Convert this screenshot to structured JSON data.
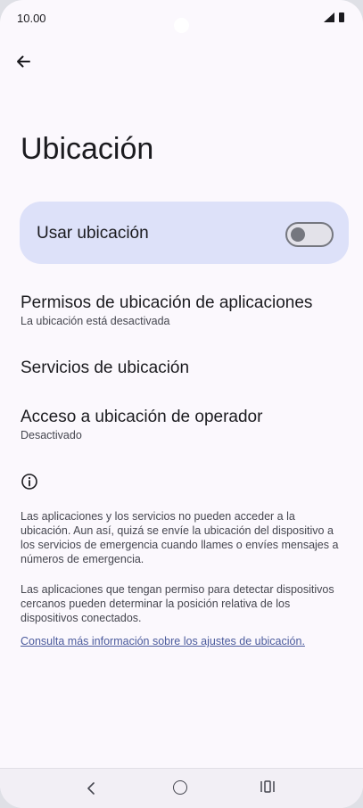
{
  "status_bar": {
    "time": "10.00",
    "icons": [
      "signal-icon",
      "battery-icon"
    ]
  },
  "header": {
    "back_icon": "arrow-left-icon",
    "title": "Ubicación"
  },
  "main_switch": {
    "label": "Usar ubicación",
    "enabled": false
  },
  "preferences": [
    {
      "title": "Permisos de ubicación de aplicaciones",
      "summary": "La ubicación está desactivada"
    },
    {
      "title": "Servicios de ubicación",
      "summary": ""
    },
    {
      "title": "Acceso a ubicación de operador",
      "summary": "Desactivado"
    }
  ],
  "footer": {
    "info_icon": "info-icon",
    "paragraph_1": "Las aplicaciones y los servicios no pueden acceder a la ubicación. Aun así, quizá se envíe la ubicación del dispositivo a los servicios de emergencia cuando llames o envíes mensajes a números de emergencia.",
    "paragraph_2": "Las aplicaciones que tengan permiso para detectar dispositivos cercanos pueden determinar la posición relativa de los dispositivos conectados.",
    "link": "Consulta más información sobre los ajustes de ubicación."
  },
  "nav_bar": {
    "icons": [
      "nav-back-icon",
      "nav-home-icon",
      "nav-recents-icon"
    ]
  },
  "colors": {
    "background": "#fbf8fd",
    "switch_card": "#dde1f9",
    "link": "#4a5a9c",
    "text_primary": "#1b1b1f",
    "text_secondary": "#45464f"
  }
}
